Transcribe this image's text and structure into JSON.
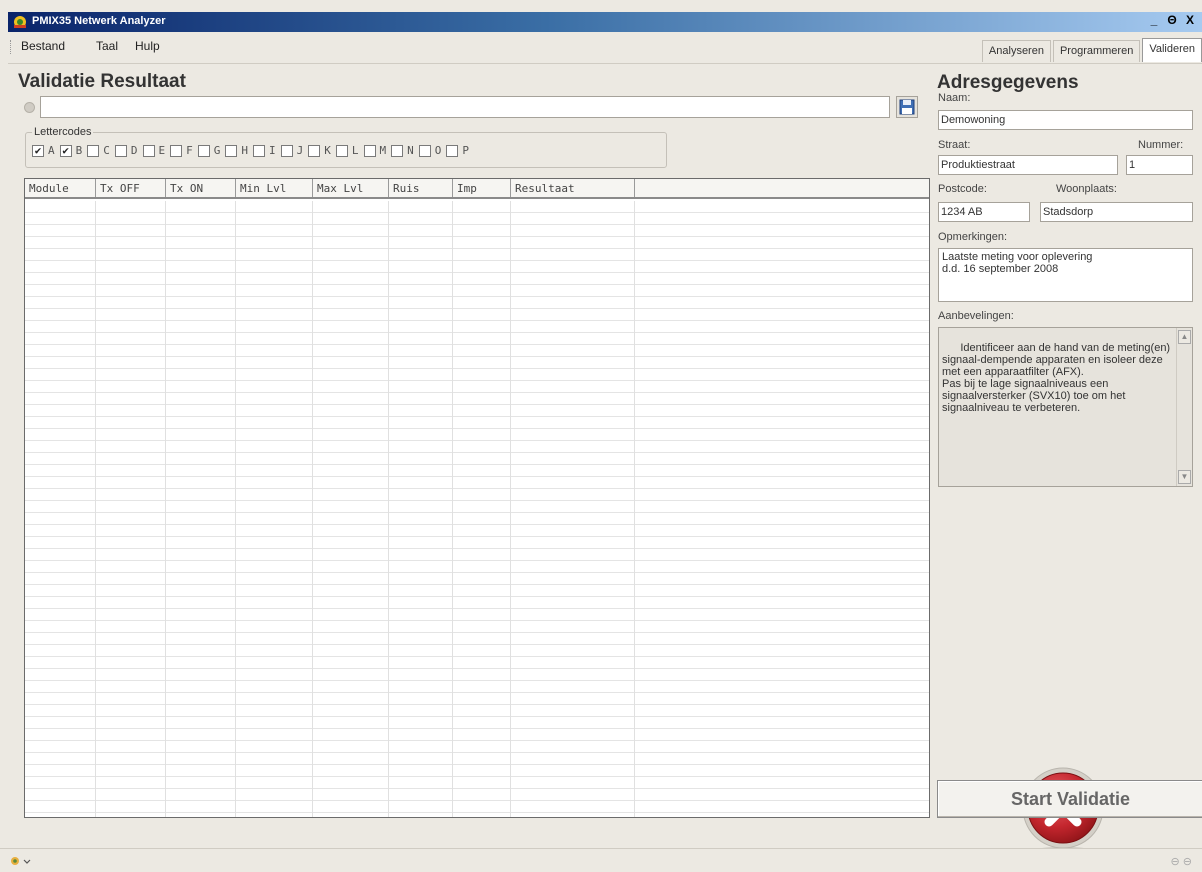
{
  "window": {
    "title": "PMIX35 Netwerk Analyzer",
    "controls": [
      "_",
      "Θ",
      "X"
    ]
  },
  "menu": [
    "Bestand",
    "Taal",
    "Hulp"
  ],
  "tabs": [
    {
      "label": "Analyseren",
      "active": false
    },
    {
      "label": "Programmeren",
      "active": false
    },
    {
      "label": "Valideren",
      "active": true
    }
  ],
  "validation": {
    "heading": "Validatie Resultaat",
    "file_path": "",
    "lettercodes_label": "Lettercodes",
    "letters": [
      {
        "code": "A",
        "checked": true
      },
      {
        "code": "B",
        "checked": true
      },
      {
        "code": "C",
        "checked": false
      },
      {
        "code": "D",
        "checked": false
      },
      {
        "code": "E",
        "checked": false
      },
      {
        "code": "F",
        "checked": false
      },
      {
        "code": "G",
        "checked": false
      },
      {
        "code": "H",
        "checked": false
      },
      {
        "code": "I",
        "checked": false
      },
      {
        "code": "J",
        "checked": false
      },
      {
        "code": "K",
        "checked": false
      },
      {
        "code": "L",
        "checked": false
      },
      {
        "code": "M",
        "checked": false
      },
      {
        "code": "N",
        "checked": false
      },
      {
        "code": "O",
        "checked": false
      },
      {
        "code": "P",
        "checked": false
      }
    ],
    "columns": [
      "Module",
      "Tx OFF",
      "Tx ON",
      "Min Lvl",
      "Max Lvl",
      "Ruis",
      "Imp",
      "Resultaat"
    ],
    "rows": []
  },
  "address": {
    "heading": "Adresgegevens",
    "naam_label": "Naam:",
    "naam": "Demowoning",
    "straat_label": "Straat:",
    "straat": "Produktiestraat",
    "nummer_label": "Nummer:",
    "nummer": "1",
    "postcode_label": "Postcode:",
    "postcode": "1234 AB",
    "woonplaats_label": "Woonplaats:",
    "woonplaats": "Stadsdorp",
    "opmerkingen_label": "Opmerkingen:",
    "opmerkingen": "Laatste meting voor oplevering\nd.d. 16 september 2008",
    "aanbevelingen_label": "Aanbevelingen:",
    "aanbevelingen": "Identificeer aan de hand van de meting(en) signaal-dempende apparaten en isoleer deze met een apparaatfilter (AFX).\nPas bij te lage signaalniveaus een signaalversterker (SVX10) toe om het signaalniveau te verbeteren."
  },
  "result": {
    "status_icon": "fail-x-icon",
    "start_button": "Start Validatie"
  },
  "colors": {
    "titlebar": "#0a246a",
    "background": "#ece9e2",
    "fail_red": "#c4262e"
  }
}
